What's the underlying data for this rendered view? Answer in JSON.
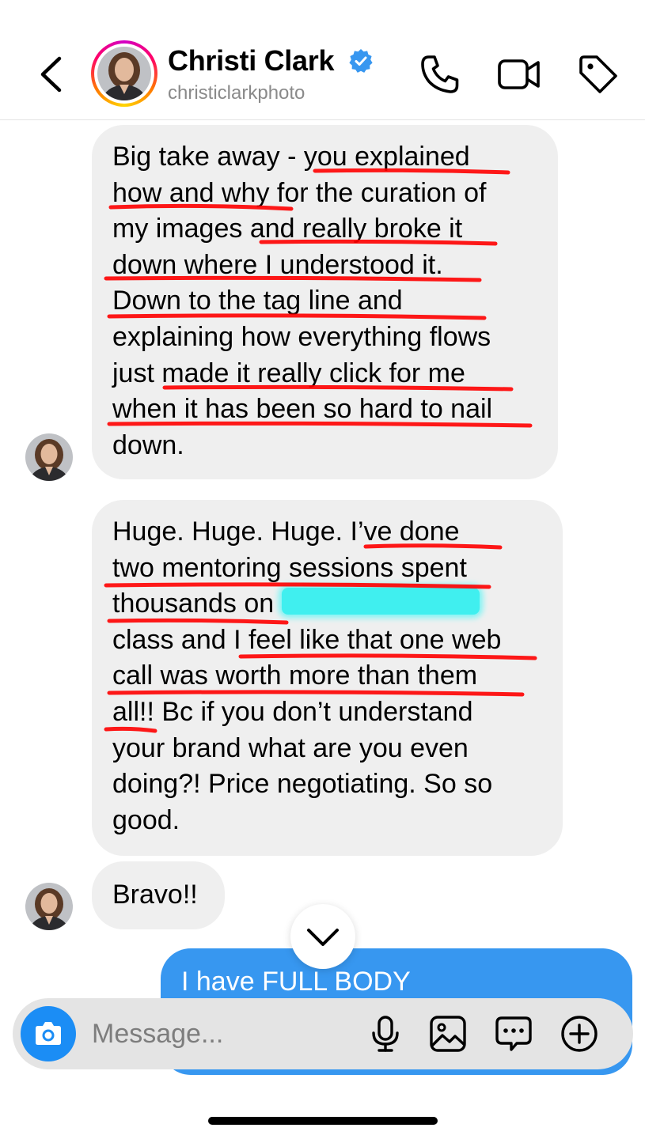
{
  "header": {
    "contact_name": "Christi Clark",
    "username": "christiclarkphoto",
    "verified": true,
    "icons": [
      "back-chevron-icon",
      "phone-icon",
      "video-camera-icon",
      "tag-icon",
      "verified-badge-icon"
    ]
  },
  "messages": [
    {
      "sender": "contact",
      "lines": [
        "Big take away - you explained",
        "how and why for the curation of",
        "my images and really broke it",
        "down where I understood it.",
        "Down to the tag line and",
        "explaining how everything flows",
        "just made it really click for me",
        "when it has been so hard to nail",
        "down."
      ]
    },
    {
      "sender": "contact",
      "lines": [
        "Huge. Huge. Huge. I’ve done",
        "two mentoring sessions spent",
        "thousands on",
        "class and I feel like that one web",
        "call was worth more than them",
        "all!! Bc if you don’t understand",
        "your brand what are you even",
        "doing?! Price negotiating. So so",
        "good."
      ]
    },
    {
      "sender": "contact",
      "lines": [
        "Bravo!!"
      ]
    },
    {
      "sender": "me",
      "lines": [
        "I have FULL BODY"
      ]
    }
  ],
  "composer": {
    "placeholder": "Message...",
    "icons": [
      "camera-icon",
      "microphone-icon",
      "gallery-icon",
      "sticker-icon",
      "plus-icon"
    ]
  },
  "colors": {
    "incoming_bubble": "#efefef",
    "outgoing_bubble": "#3797f0",
    "verified_blue": "#3897f0",
    "camera_button": "#1b8df5",
    "annotation_red": "#ff0000",
    "redaction_cyan": "#2ef0f0"
  }
}
